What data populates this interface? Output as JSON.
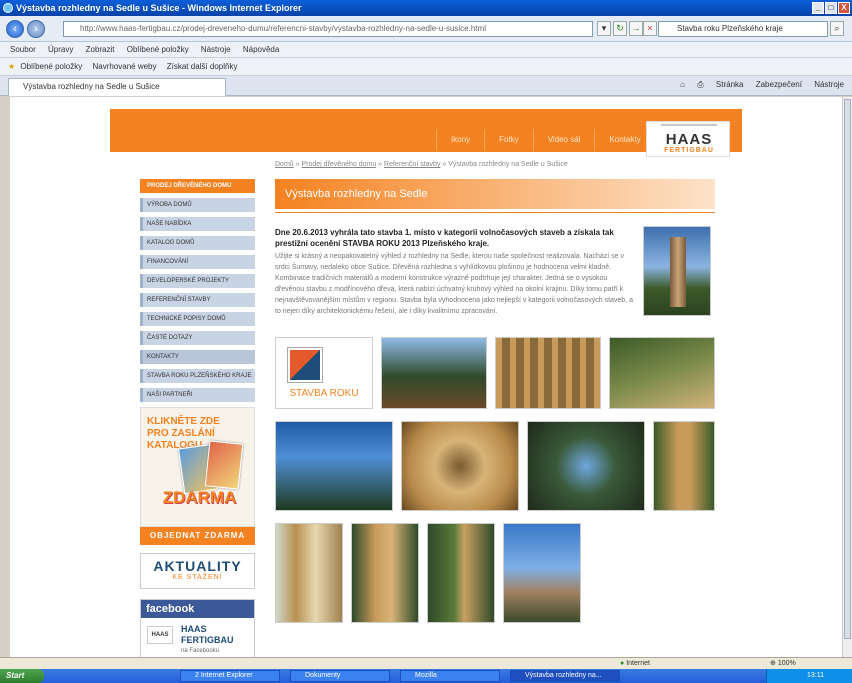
{
  "window": {
    "title": "Výstavba rozhledny na Sedle u Sušice - Windows Internet Explorer",
    "controls": [
      "_",
      "□",
      "X"
    ]
  },
  "addressbar": {
    "url": "http://www.haas-fertigbau.cz/prodej-dreveneho-dumu/referencni-stavby/vystavba-rozhledny-na-sedle-u-susice.html",
    "search_placeholder": "Stavba roku Plzeňského kraje"
  },
  "menubar": [
    "Soubor",
    "Úpravy",
    "Zobrazit",
    "Oblíbené položky",
    "Nástroje",
    "Nápověda"
  ],
  "favorites": {
    "label": "Oblíbené položky",
    "items": [
      "Navrhované weby",
      "Získat další doplňky"
    ]
  },
  "tab": {
    "label": "Výstavba rozhledny na Sedle u Sušice"
  },
  "commandbar": [
    "Stránka",
    "Zabezpečení",
    "Nástroje"
  ],
  "site": {
    "topnav": [
      "Ikony",
      "Fotky",
      "Video sál",
      "Kontakty"
    ],
    "logo": {
      "main": "HAAS",
      "sub": "FERTIGBAU"
    },
    "breadcrumb": {
      "home": "Domů",
      "section": "Prodej dřevěného domu",
      "subsection": "Referenční stavby",
      "current": "Výstavba rozhledny na Sedle u Sušice",
      "sep": "»"
    },
    "sidebar": [
      "PRODEJ DŘEVĚNÉHO DOMU",
      "VÝROBA DOMŮ",
      "NAŠE NABÍDKA",
      "KATALOG DOMŮ",
      "FINANCOVÁNÍ",
      "DEVELOPERSKÉ PROJEKTY",
      "REFERENČNÍ STAVBY",
      "TECHNICKÉ POPISY DOMŮ",
      "ČASTÉ DOTAZY",
      "KONTAKTY",
      "STAVBA ROKU PLZEŇSKÉHO KRAJE",
      "NAŠI PARTNEŘI"
    ],
    "catalog_promo": {
      "text": "KLIKNĚTE ZDE PRO ZASLÁNÍ KATALOGU",
      "free": "ZDARMA"
    },
    "order_button": "OBJEDNAT ZDARMA",
    "news": {
      "title": "AKTUALITY",
      "subtitle": "KE STAŽENÍ"
    },
    "facebook": {
      "header": "facebook",
      "name": "HAAS FERTIGBAU",
      "sub": "na Facebooku",
      "logo": "HAAS"
    },
    "content": {
      "title": "Výstavba rozhledny na Sedle",
      "lead": "Dne 20.6.2013 vyhrála tato stavba 1. místo v kategorii volnočasových staveb a získala tak prestižní ocenění STAVBA ROKU 2013 Plzeňského kraje.",
      "body": "Užijte si krásný a neopakovatelný výhled z rozhledny na Sedle, kterou naše společnost realizovala. Nachází se v srdci Šumavy, nedaleko obce Sušice. Dřevěná rozhledna s vyhlídkovou plošinou je hodnocena velmi kladně. Kombinace tradičních materiálů a moderní konstrukce výrazně podtrhuje její charakter. Jedná se o vysokou dřevěnou stavbu z modřínového dřeva, která nabízí úchvatný kruhový výhled na okolní krajinu. Díky tomu patří k nejnavštěvovanějším místům v regionu. Stavba byla vyhodnocena jako nejlepší v kategorii volnočasových staveb, a to nejen díky architektonickému řešení, ale i díky kvalitnímu zpracování.",
      "stavba_label": "STAVBA ROKU"
    }
  },
  "statusbar": {
    "zone": "Internet",
    "zoom": "100%"
  },
  "taskbar": {
    "start": "Start",
    "tasks": [
      "2 Internet Explorer",
      "Dokumenty",
      "Mozilla",
      "Výstavba rozhledny na..."
    ],
    "clock": "13:11"
  }
}
